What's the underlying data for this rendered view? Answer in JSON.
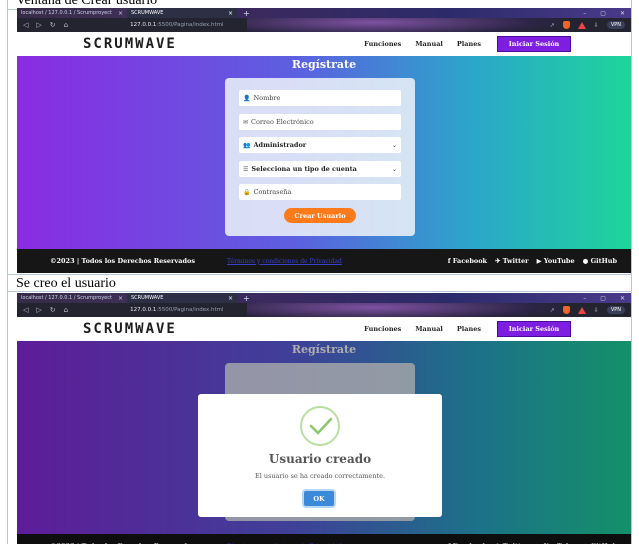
{
  "captions": {
    "first": "Ventana de Crear usuario",
    "second": "Se creo el usuario"
  },
  "browser": {
    "tab1_title": "localhost / 127.0.0.1 / Scrumproyect",
    "tab2_title": "SCRUMWAVE",
    "url_host": "127.0.0.1",
    "url_path": ":5500/Pagina/index.html",
    "vpn_label": "VPN",
    "controls": [
      "–",
      "▢",
      "✕"
    ],
    "close": "×",
    "new_tab": "+",
    "nav": [
      "◁",
      "▷",
      "↻",
      "⌂"
    ],
    "icons": [
      "↗",
      "⇩"
    ]
  },
  "site": {
    "logo": "SCRUMWAVE",
    "menu": [
      "Funciones",
      "Manual",
      "Planes"
    ],
    "login_button": "Iniciar Sesión",
    "hero_title": "Regístrate",
    "fields": {
      "name": "Nombre",
      "email": "Correo Electrónico",
      "role": "Administrador",
      "account_type": "Selecciona un tipo de cuenta",
      "password": "Contraseña"
    },
    "create_button": "Crear Usuario",
    "footer": {
      "copyright": "©2023 | Todos los Derechos Reservados",
      "link": "Términos y condiciones de Privacidad",
      "social": [
        "Facebook",
        "Twitter",
        "YouTube",
        "GitHub"
      ]
    }
  },
  "modal": {
    "title": "Usuario creado",
    "message": "El usuario se ha creado correctamente.",
    "ok": "OK"
  },
  "colors": {
    "accent": "#7e1ee0",
    "cta": "#ff7a1a",
    "success": "#8cc66a",
    "ok": "#3b8ad9"
  }
}
